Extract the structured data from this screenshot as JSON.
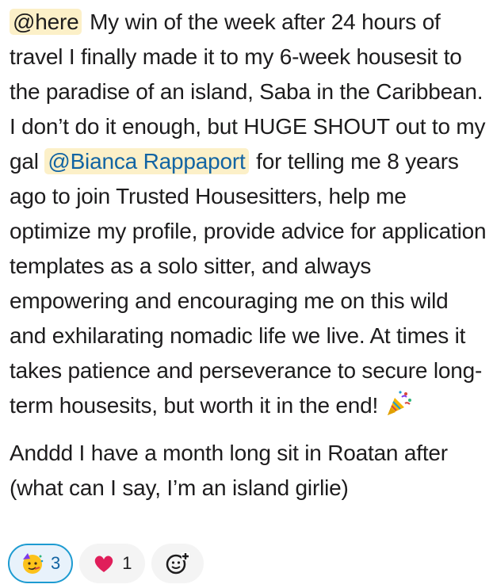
{
  "message": {
    "mention_here": "@here",
    "p1_part1": "My win of the week after 24 hours of travel I finally made it to my 6-week housesit to the paradise of an island, Saba in the Caribbean. I don’t do it enough, but HUGE SHOUT out to my gal",
    "mention_user": "@Bianca Rappaport",
    "p1_part2": "for telling me 8 years ago to join Trusted Housesitters, help me optimize my profile, provide advice for application templates as a solo sitter, and always empowering and encouraging me on this wild and exhilarating nomadic life we live. At times it takes patience and perseverance to secure long-term housesits, but worth it in the end!",
    "p1_emoji": "party-popper-emoji",
    "p2": "Anddd I have a month long sit in Roatan after (what can I say, I’m an island girlie)"
  },
  "reactions": [
    {
      "emoji": "partying-face-emoji",
      "count": "3",
      "active": true
    },
    {
      "emoji": "red-heart-emoji",
      "count": "1",
      "active": false
    },
    {
      "emoji": "add-reaction-icon",
      "count": "",
      "active": false
    }
  ],
  "colors": {
    "mention_bg": "#fcf0c8",
    "mention_user_text": "#1264a3",
    "reaction_active_border": "#1d9bd1",
    "reaction_active_bg": "#e8f2fb"
  }
}
